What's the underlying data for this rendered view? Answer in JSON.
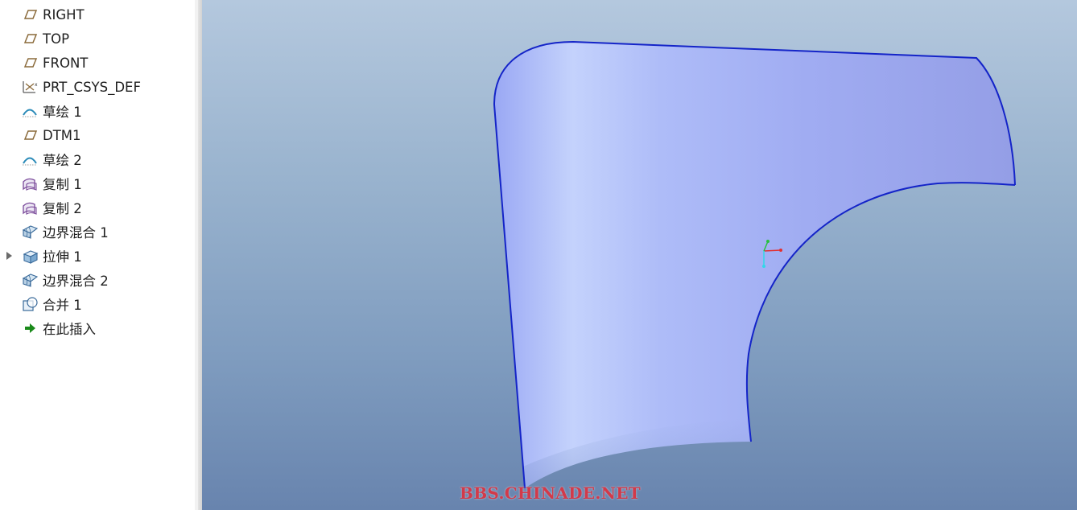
{
  "model_tree": {
    "items": [
      {
        "label": "RIGHT",
        "icon": "datum-plane-icon"
      },
      {
        "label": "TOP",
        "icon": "datum-plane-icon"
      },
      {
        "label": "FRONT",
        "icon": "datum-plane-icon"
      },
      {
        "label": "PRT_CSYS_DEF",
        "icon": "coordinate-system-icon"
      },
      {
        "label": "草绘 1",
        "icon": "sketch-icon"
      },
      {
        "label": "DTM1",
        "icon": "datum-plane-icon"
      },
      {
        "label": "草绘 2",
        "icon": "sketch-icon"
      },
      {
        "label": "复制 1",
        "icon": "copy-surface-icon"
      },
      {
        "label": "复制 2",
        "icon": "copy-surface-icon"
      },
      {
        "label": "边界混合 1",
        "icon": "boundary-blend-icon"
      },
      {
        "label": "拉伸 1",
        "icon": "extrude-icon",
        "expandable": true
      },
      {
        "label": "边界混合 2",
        "icon": "boundary-blend-icon"
      },
      {
        "label": "合并 1",
        "icon": "merge-icon"
      },
      {
        "label": "在此插入",
        "icon": "insert-here-arrow-icon"
      }
    ]
  },
  "viewport": {
    "surface_color": "#a4b0f2",
    "edge_color": "#1424c8",
    "watermark": "BBS.CHINADE.NET"
  },
  "colors": {
    "plane_icon": "#8a6a3a",
    "sketch_icon": "#2a8ab8",
    "copy_icon": "#7a4a9a",
    "insert_arrow": "#1a8a1a"
  }
}
